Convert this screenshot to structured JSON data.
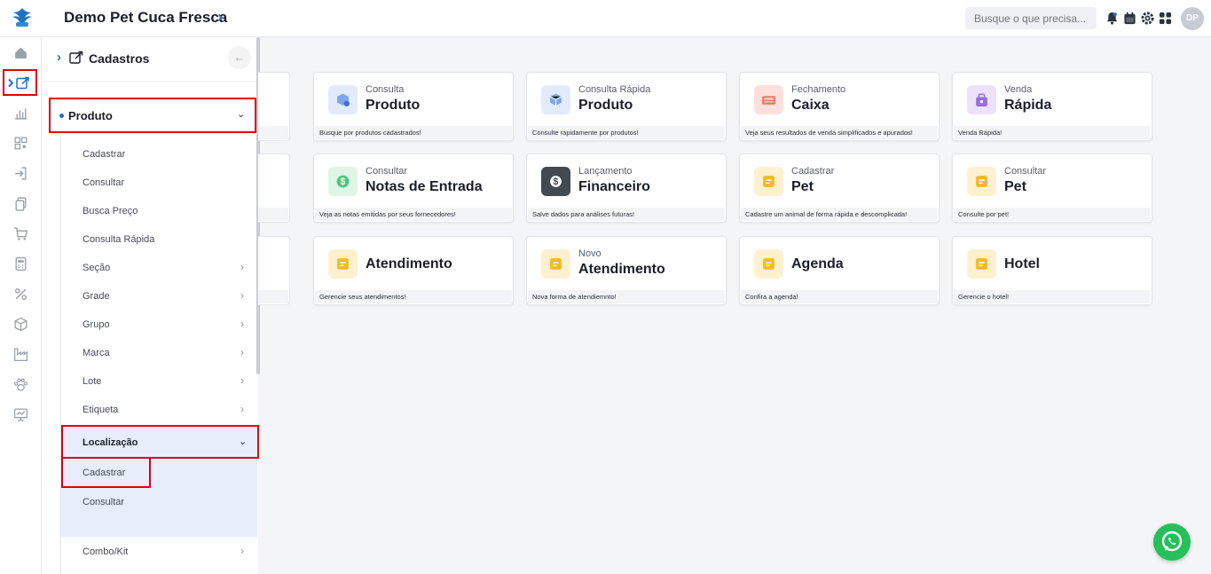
{
  "header": {
    "title": "Demo Pet Cuca Fresca",
    "search_placeholder": "Busque o que precisa...",
    "avatar_initials": "DP"
  },
  "drawer": {
    "title": "Cadastros",
    "group": "Produto",
    "items": [
      {
        "label": "Cadastrar"
      },
      {
        "label": "Consultar"
      },
      {
        "label": "Busca Preço"
      },
      {
        "label": "Consulta Rápida"
      },
      {
        "label": "Seção"
      },
      {
        "label": "Grade"
      },
      {
        "label": "Grupo"
      },
      {
        "label": "Marca"
      },
      {
        "label": "Lote"
      },
      {
        "label": "Etiqueta"
      }
    ],
    "localizacao": {
      "label": "Localização",
      "items": [
        {
          "label": "Cadastrar"
        },
        {
          "label": "Consultar"
        }
      ]
    },
    "combo": {
      "label": "Combo/Kit"
    }
  },
  "cards": [
    {
      "sub": "Consulta",
      "title": "Produto",
      "footer": "Busque por produtos cadastrados!",
      "color": "#e1ebfb"
    },
    {
      "sub": "Consulta Rápida",
      "title": "Produto",
      "footer": "Consulte rapidamente por produtos!",
      "color": "#e1ebfb"
    },
    {
      "sub": "Fechamento",
      "title": "Caixa",
      "footer": "Veja seus resultados de venda simplificados e apurados!",
      "color": "#fde0dc"
    },
    {
      "sub": "Venda",
      "title": "Rápida",
      "footer": "Venda Rápida!",
      "color": "#ece2fb"
    },
    {
      "sub": "Consultar",
      "title": "Notas de Entrada",
      "footer": "Veja as notas emitidas por seus fornecedores!",
      "color": "#dff5e6"
    },
    {
      "sub": "Lançamento",
      "title": "Financeiro",
      "footer": "Salve dados para análises futuras!",
      "color": "#444851"
    },
    {
      "sub": "Cadastrar",
      "title": "Pet",
      "footer": "Cadastre um animal de forma rápida e descomplicada!",
      "color": "#fdf1cf"
    },
    {
      "sub": "Consultar",
      "title": "Pet",
      "footer": "Consulte por pet!",
      "color": "#fdf1cf"
    },
    {
      "sub": "",
      "title": "Atendimento",
      "footer": "Gerencie seus atendimentos!",
      "color": "#fdf1cf"
    },
    {
      "sub": "Novo",
      "title": "Atendimento",
      "footer": "Nova forma de atendiemnto!",
      "color": "#fdf1cf"
    },
    {
      "sub": "",
      "title": "Agenda",
      "footer": "Confira a agenda!",
      "color": "#fdf1cf"
    },
    {
      "sub": "",
      "title": "Hotel",
      "footer": "Gerencie o hotel!",
      "color": "#fdf1cf"
    }
  ],
  "colors": {
    "accent": "#1a6fd1",
    "highlight_border": "#e0000e",
    "whatsapp": "#25c05a"
  }
}
